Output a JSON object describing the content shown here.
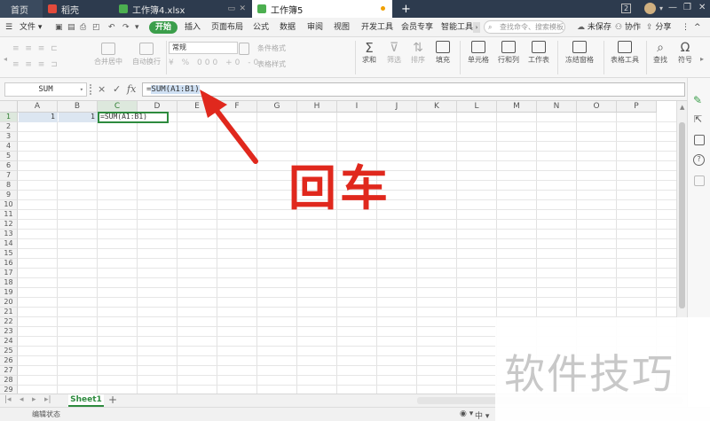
{
  "tabs": [
    {
      "label": "首页",
      "active": false
    },
    {
      "label": "稻壳",
      "active": false
    },
    {
      "label": "工作簿4.xlsx",
      "active": false
    },
    {
      "label": "工作簿5",
      "active": true
    }
  ],
  "title_controls": {
    "tabs_count": "2",
    "new_tab": "+"
  },
  "menu": {
    "file": "文件",
    "items": [
      "开始",
      "插入",
      "页面布局",
      "公式",
      "数据",
      "审阅",
      "视图",
      "开发工具",
      "会员专享",
      "智能工具"
    ],
    "search_placeholder": "查找命令、搜索模板",
    "unsaved": "未保存",
    "collab": "协作",
    "share": "分享"
  },
  "ribbon": {
    "format_normal": "常规",
    "merge_center": "合并居中",
    "wrap": "自动换行",
    "cond_format": "条件格式",
    "table_style": "表格样式",
    "sum": "求和",
    "filter": "筛选",
    "sort": "排序",
    "fill": "填充",
    "cell": "单元格",
    "row_col": "行和列",
    "worksheet": "工作表",
    "freeze": "冻结窗格",
    "table_tools": "表格工具",
    "find": "查找",
    "symbol": "符号",
    "currency": "¥",
    "percent": "%",
    "thousands": "000",
    "dec_inc": "+0",
    "dec_dec": "-0"
  },
  "formula_bar": {
    "name_box": "SUM",
    "cancel": "×",
    "confirm": "✓",
    "fx": "fx",
    "formula_prefix": "=",
    "formula_ref": "SUM(A1:B1)"
  },
  "grid": {
    "columns": [
      "A",
      "B",
      "C",
      "D",
      "E",
      "F",
      "G",
      "H",
      "I",
      "J",
      "K",
      "L",
      "M",
      "N",
      "O",
      "P"
    ],
    "rows": [
      "1",
      "2",
      "3",
      "4",
      "5",
      "6",
      "7",
      "8",
      "9",
      "10",
      "11",
      "12",
      "13",
      "14",
      "15",
      "16",
      "17",
      "18",
      "19",
      "20",
      "21",
      "22",
      "23",
      "24",
      "25",
      "26",
      "27",
      "28",
      "29"
    ],
    "cells": {
      "A1": "1",
      "B1": "1",
      "C1": "=SUM(A1:B1)"
    }
  },
  "sheets": {
    "active": "Sheet1",
    "add": "+"
  },
  "status": {
    "text": "编辑状态"
  },
  "annotation": {
    "text": "回车"
  },
  "watermark": {
    "text": "软件技巧"
  },
  "colors": {
    "accent_green": "#3b9e4b",
    "annotation_red": "#e0281d",
    "titlebar": "#2d3b4e"
  }
}
